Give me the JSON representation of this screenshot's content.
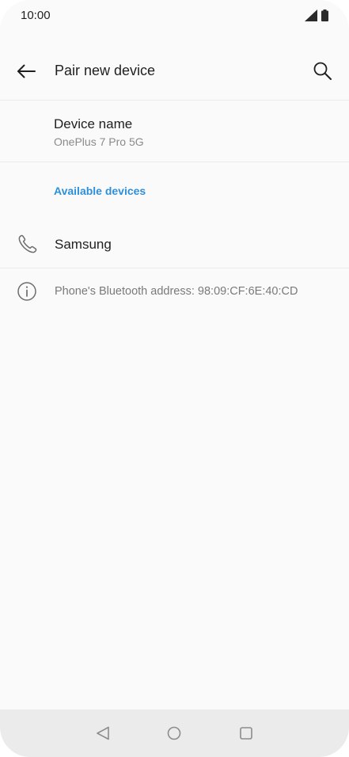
{
  "status_bar": {
    "time": "10:00",
    "icons": [
      "signal-icon",
      "battery-icon"
    ]
  },
  "app_bar": {
    "title": "Pair new device",
    "back_icon": "arrow-left-icon",
    "search_icon": "search-icon"
  },
  "device_name": {
    "label": "Device name",
    "value": "OnePlus 7 Pro 5G"
  },
  "available_devices": {
    "header": "Available devices",
    "header_color": "#2f8fd8",
    "items": [
      {
        "label": "Samsung",
        "icon": "phone-icon"
      }
    ]
  },
  "bluetooth_info": {
    "icon": "info-icon",
    "text": "Phone's Bluetooth address: 98:09:CF:6E:40:CD"
  },
  "nav_bar": {
    "buttons": [
      "back-triangle-icon",
      "home-circle-icon",
      "recents-square-icon"
    ]
  }
}
